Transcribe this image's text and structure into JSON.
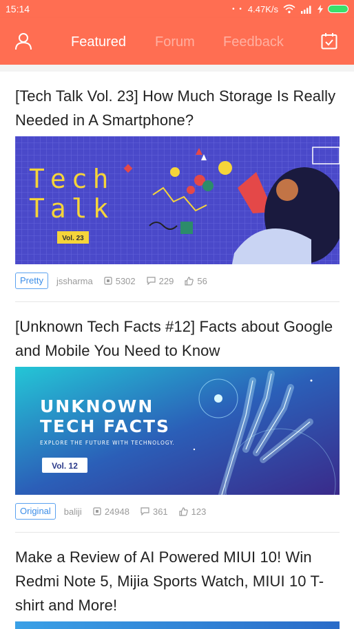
{
  "status": {
    "time": "15:14",
    "network_speed": "4.47K/s",
    "battery_color": "#38e06b"
  },
  "header": {
    "bg_color": "#ff6e52",
    "tabs": [
      {
        "label": "Featured",
        "active": true
      },
      {
        "label": "Forum",
        "active": false
      },
      {
        "label": "Feedback",
        "active": false
      }
    ],
    "left_icon": "user-icon",
    "right_icon": "calendar-check-icon"
  },
  "posts": [
    {
      "title_line1": "[Tech Talk Vol. 23] How Much Storage Is Really",
      "title_line2": "Needed in A Smartphone?",
      "banner": {
        "line1": "Tech",
        "line2": "Talk",
        "vol": "Vol. 23",
        "bg": "#4a49c9"
      },
      "tag": "Pretty",
      "author": "jssharma",
      "views": "5302",
      "comments": "229",
      "likes": "56"
    },
    {
      "title_line1": "[Unknown Tech Facts #12] Facts about Google",
      "title_line2": "and Mobile You Need to Know",
      "banner": {
        "line1": "UNKNOWN",
        "line2": "TECH FACTS",
        "subtitle": "EXPLORE THE FUTURE WITH TECHNOLOGY.",
        "vol": "Vol. 12"
      },
      "tag": "Original",
      "author": "baliji",
      "views": "24948",
      "comments": "361",
      "likes": "123"
    },
    {
      "title_line1": "Make a Review of AI Powered MIUI 10! Win",
      "title_line2": "Redmi Note 5, Mijia Sports Watch, MIUI 10 T-",
      "title_line3": "shirt and More!"
    }
  ]
}
